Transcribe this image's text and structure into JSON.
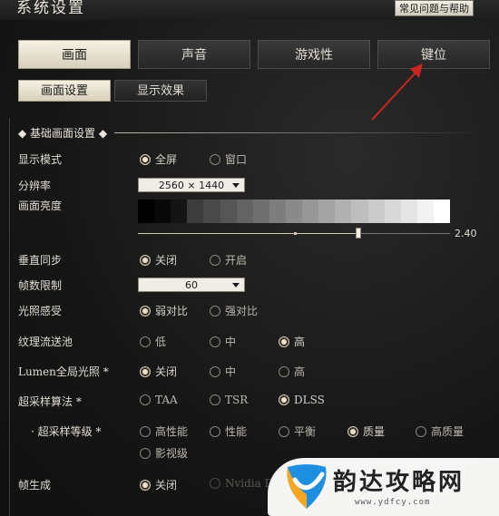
{
  "window": {
    "title": "系统设置",
    "help_label": "常见问题与帮助"
  },
  "tabs": [
    {
      "label": "画面",
      "active": true
    },
    {
      "label": "声音",
      "active": false
    },
    {
      "label": "游戏性",
      "active": false
    },
    {
      "label": "键位",
      "active": false
    }
  ],
  "subtabs": [
    {
      "label": "画面设置",
      "active": true
    },
    {
      "label": "显示效果",
      "active": false
    }
  ],
  "section": {
    "title": "基础画面设置"
  },
  "settings": {
    "display_mode": {
      "label": "显示模式",
      "options": [
        "全屏",
        "窗口"
      ],
      "selected": "全屏"
    },
    "resolution": {
      "label": "分辨率",
      "value": "2560 × 1440"
    },
    "brightness": {
      "label": "画面亮度",
      "value": "2.40",
      "fraction": 0.705
    },
    "vsync": {
      "label": "垂直同步",
      "options": [
        "关闭",
        "开启"
      ],
      "selected": "关闭"
    },
    "fps_limit": {
      "label": "帧数限制",
      "value": "60"
    },
    "lighting": {
      "label": "光照感受",
      "options": [
        "弱对比",
        "强对比"
      ],
      "selected": "弱对比"
    },
    "texture_pool": {
      "label": "纹理流送池",
      "options": [
        "低",
        "中",
        "高"
      ],
      "selected": "高"
    },
    "lumen": {
      "label": "Lumen全局光照 *",
      "options": [
        "关闭",
        "中",
        "高"
      ],
      "selected": "关闭"
    },
    "upscaler": {
      "label": "超采样算法 *",
      "options": [
        "TAA",
        "TSR",
        "DLSS"
      ],
      "selected": "DLSS"
    },
    "upscale_level": {
      "label": "· 超采样等级 *",
      "options": [
        "高性能",
        "性能",
        "平衡",
        "质量",
        "高质量",
        "影视级"
      ],
      "selected": "质量"
    },
    "frame_gen": {
      "label": "帧生成",
      "options": [
        "关闭",
        "Nvidia DLSS"
      ],
      "selected": "关闭"
    }
  },
  "watermark": {
    "brand": "韵达攻略网",
    "url": "www.ydfcy.com"
  },
  "colors": {
    "accent": "#f6f1e4",
    "arrow": "#c8261e",
    "background": "#1a1a1a"
  }
}
